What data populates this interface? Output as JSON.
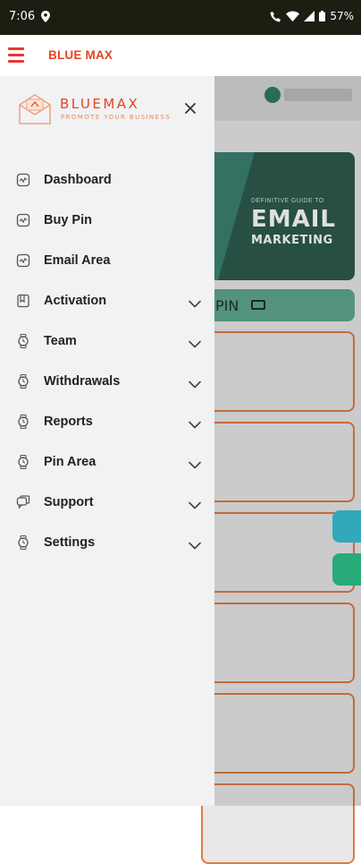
{
  "status_bar": {
    "time": "7:06",
    "battery": "57%"
  },
  "app_bar": {
    "title": "BLUE MAX"
  },
  "drawer": {
    "logo": {
      "brand": "BLUEMAX",
      "tagline": "PROMOTE YOUR BUSINESS"
    },
    "items": [
      {
        "label": "Dashboard",
        "icon": "chart-icon",
        "expandable": false
      },
      {
        "label": "Buy Pin",
        "icon": "chart-icon",
        "expandable": false
      },
      {
        "label": "Email Area",
        "icon": "chart-icon",
        "expandable": false
      },
      {
        "label": "Activation",
        "icon": "book-icon",
        "expandable": true
      },
      {
        "label": "Team",
        "icon": "clock-icon",
        "expandable": true
      },
      {
        "label": "Withdrawals",
        "icon": "clock-icon",
        "expandable": true
      },
      {
        "label": "Reports",
        "icon": "clock-icon",
        "expandable": true
      },
      {
        "label": "Pin Area",
        "icon": "clock-icon",
        "expandable": true
      },
      {
        "label": "Support",
        "icon": "chat-icon",
        "expandable": true
      },
      {
        "label": "Settings",
        "icon": "clock-icon",
        "expandable": true
      }
    ]
  },
  "background": {
    "banner": {
      "small_text": "DEFINITIVE GUIDE TO",
      "big_text": "EMAIL",
      "sub_text": "MARKETING"
    },
    "pin_label": "PIN"
  },
  "colors": {
    "brand": "#e8431f",
    "status_bar": "#1a1f12",
    "drawer_bg": "#f1f2f4",
    "banner": "#2d5a4d",
    "pin_bar": "#5fa890",
    "card_border": "#e07a45",
    "fab_top": "#3bbfd6",
    "fab_bottom": "#2ec28a"
  }
}
